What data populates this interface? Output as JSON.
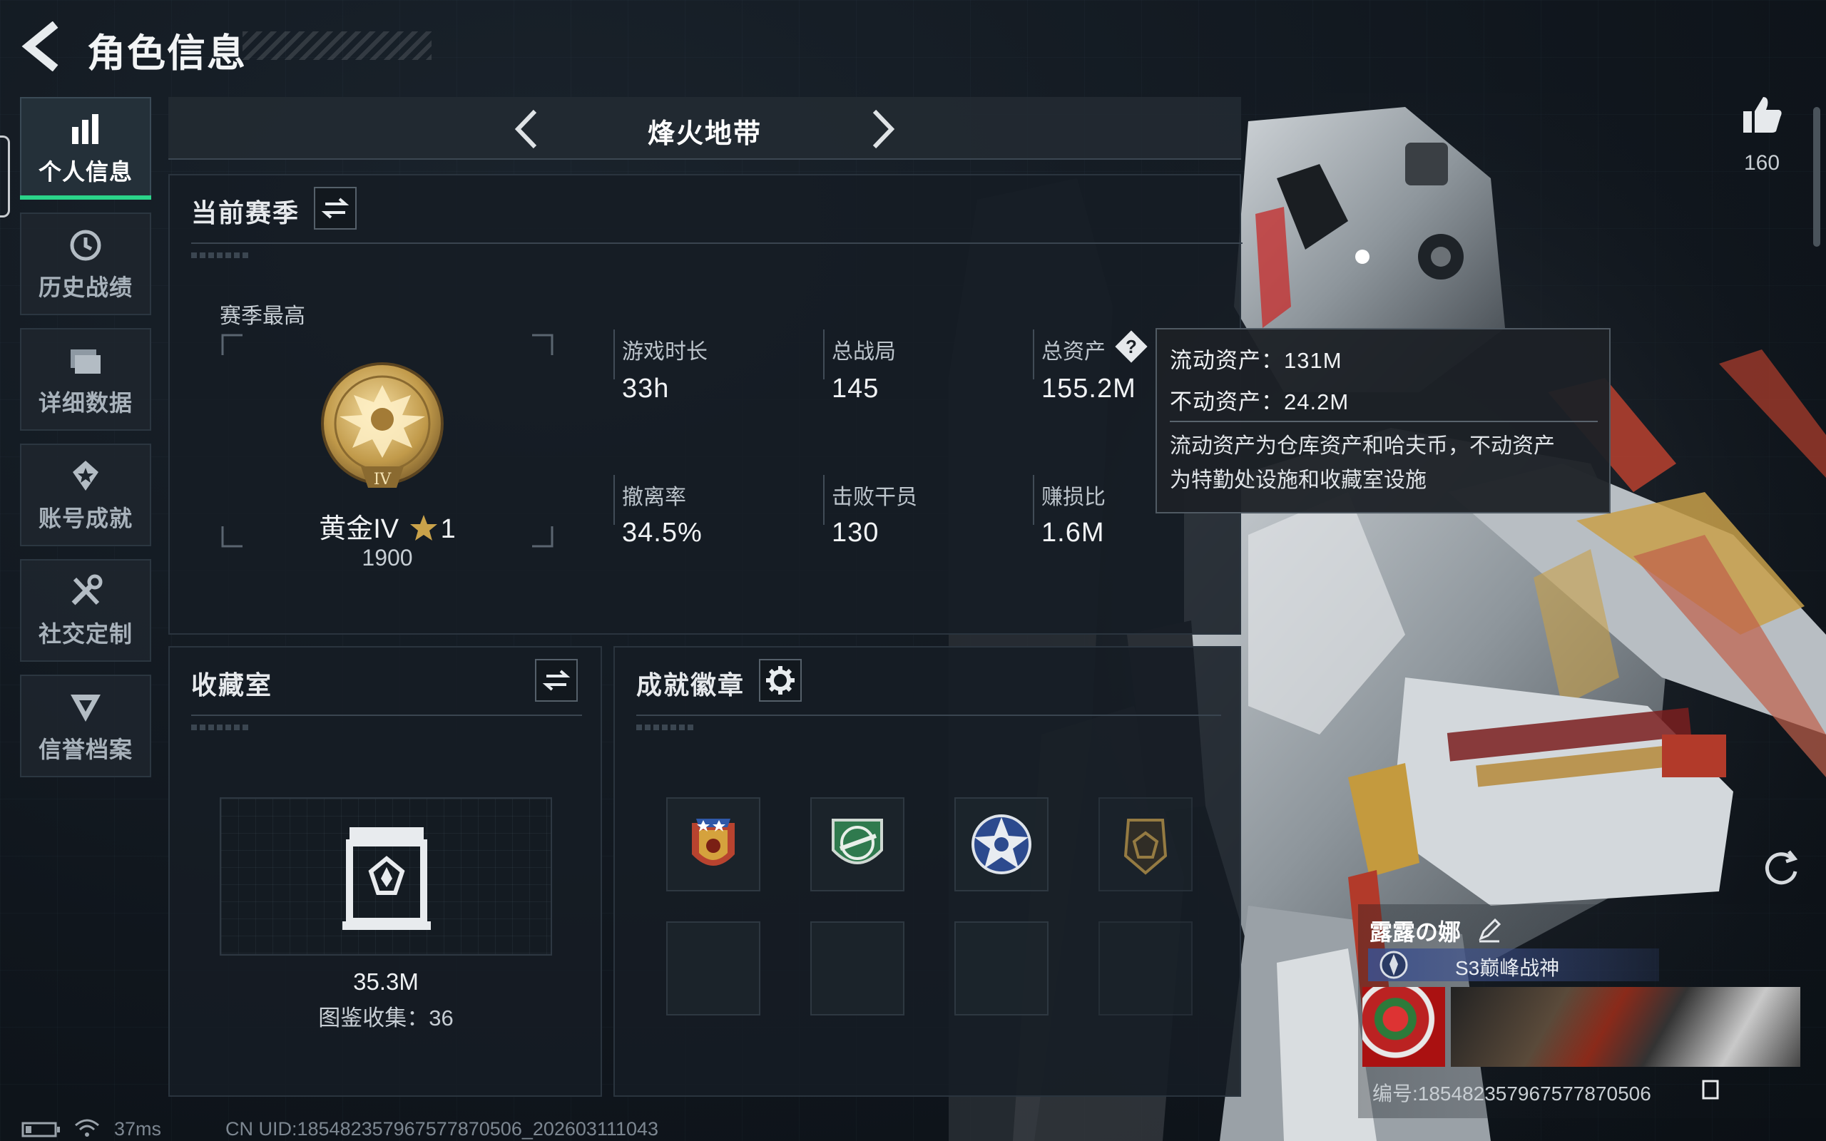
{
  "header": {
    "title": "角色信息"
  },
  "nav": {
    "items": [
      {
        "label": "个人信息",
        "icon": "bar-chart-icon",
        "active": true
      },
      {
        "label": "历史战绩",
        "icon": "history-clock-icon",
        "active": false
      },
      {
        "label": "详细数据",
        "icon": "folder-icon",
        "active": false
      },
      {
        "label": "账号成就",
        "icon": "achievement-star-icon",
        "active": false
      },
      {
        "label": "社交定制",
        "icon": "tools-icon",
        "active": false
      },
      {
        "label": "信誉档案",
        "icon": "credit-emblem-icon",
        "active": false
      }
    ]
  },
  "mode": {
    "title": "烽火地带"
  },
  "season": {
    "title": "当前赛季",
    "best_label": "赛季最高",
    "rank_name": "黄金IV",
    "rank_stars": "1",
    "rank_badge_numeral": "IV",
    "rank_score": "1900",
    "stats": [
      {
        "label": "游戏时长",
        "value": "33h"
      },
      {
        "label": "总战局",
        "value": "145"
      },
      {
        "label": "总资产",
        "value": "155.2M"
      },
      {
        "label": "撤离率",
        "value": "34.5%"
      },
      {
        "label": "击败干员",
        "value": "130"
      },
      {
        "label": "赚损比",
        "value": "1.6M"
      }
    ]
  },
  "tooltip": {
    "liquid": "流动资产：131M",
    "fixed": "不动资产：24.2M",
    "desc_line1": "流动资产为仓库资产和哈夫币，不动资产",
    "desc_line2": "为特勤处设施和收藏室设施"
  },
  "collection": {
    "title": "收藏室",
    "value": "35.3M",
    "count": "图鉴收集：36"
  },
  "badges": {
    "title": "成就徽章"
  },
  "likes": {
    "count": "160"
  },
  "character": {
    "name": "露露の娜",
    "title": "S3巅峰战神",
    "serial": "编号:185482357967577870506"
  },
  "status": {
    "ping": "37ms",
    "uid": "CN UID:185482357967577870506_202603111043"
  },
  "colors": {
    "accent": "#2bd48a",
    "gold": "#c9a24a",
    "panel": "#161d24"
  }
}
